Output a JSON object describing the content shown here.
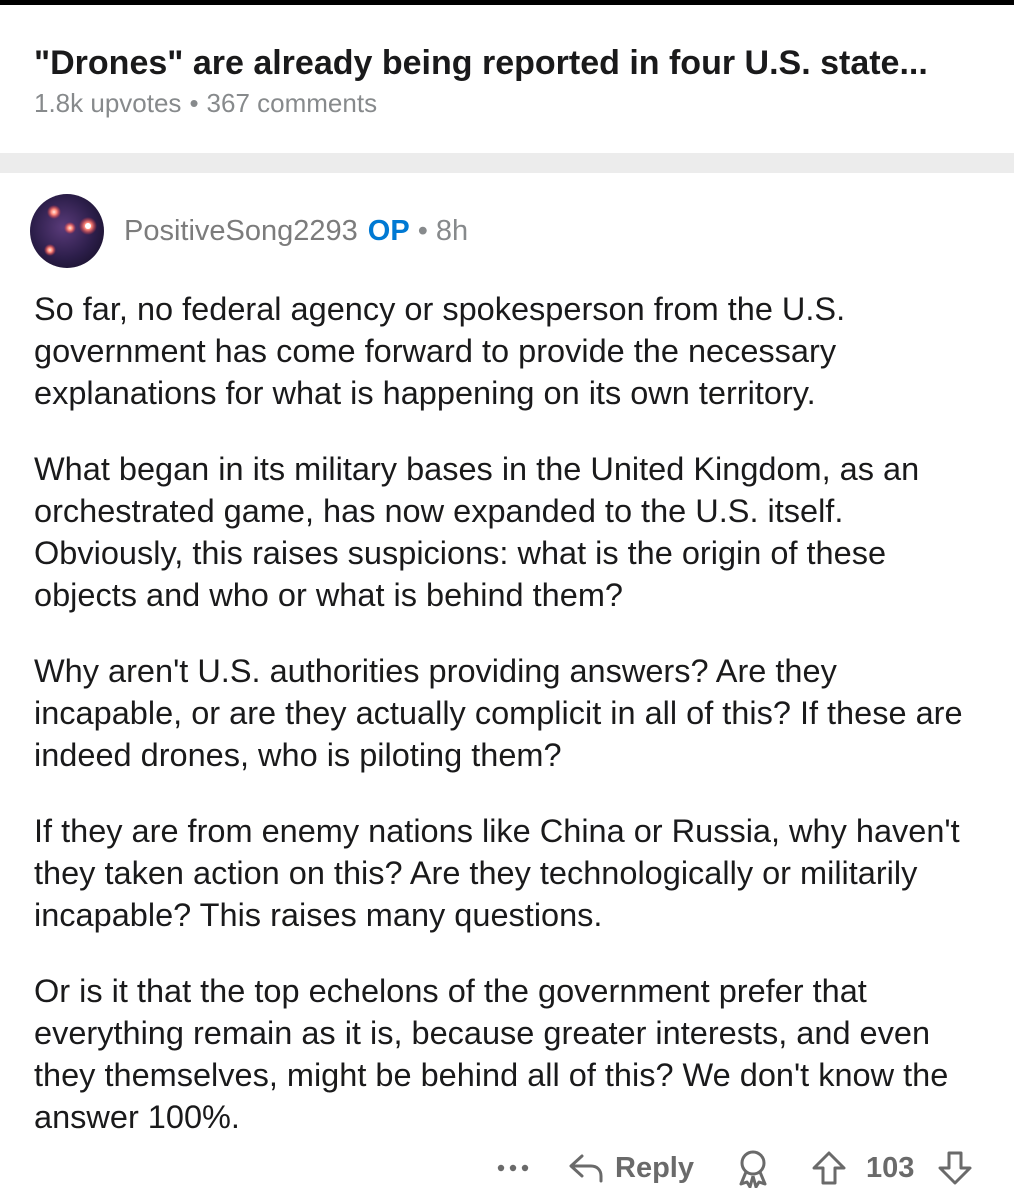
{
  "post": {
    "title": "\"Drones\" are already being reported in four U.S. state...",
    "upvotes": "1.8k upvotes",
    "separator": "•",
    "comments": "367 comments"
  },
  "comment": {
    "author": "PositiveSong2293",
    "op_badge": "OP",
    "dot": "•",
    "age": "8h",
    "avatar_icon": "avatar-image",
    "paragraphs": [
      "So far, no federal agency or spokesperson from the U.S. government has come forward to provide the necessary explanations for what is happening on its own territory.",
      "What began in its military bases in the United Kingdom, as an orchestrated game, has now expanded to the U.S. itself. Obviously, this raises suspicions: what is the origin of these objects and who or what is behind them?",
      "Why aren't U.S. authorities providing answers? Are they incapable, or are they actually complicit in all of this? If these are indeed drones, who is piloting them?",
      "If they are from enemy nations like China or Russia, why haven't they taken action on this? Are they technologically or militarily incapable? This raises many questions.",
      "Or is it that the top echelons of the government prefer that everything remain as it is, because greater interests, and even they themselves, might be behind all of this? We don't know the answer 100%."
    ]
  },
  "actions": {
    "more_icon": "more-dots-icon",
    "reply_icon": "reply-arrow-icon",
    "reply_label": "Reply",
    "award_icon": "award-icon",
    "upvote_icon": "upvote-arrow-icon",
    "score": "103",
    "downvote_icon": "downvote-arrow-icon"
  },
  "colors": {
    "op_blue": "#0079d3",
    "meta_gray": "#878a8c",
    "action_gray": "#6a6a6a",
    "separator_gray": "#ececec"
  }
}
